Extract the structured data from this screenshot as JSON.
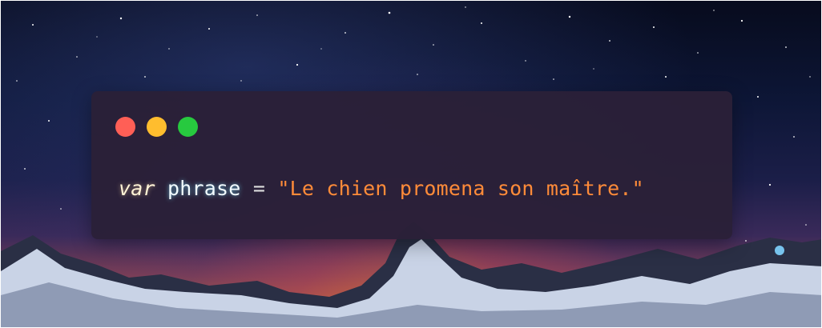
{
  "window": {
    "controls": [
      {
        "name": "close",
        "color": "#ff5f56"
      },
      {
        "name": "minimize",
        "color": "#ffbd2e"
      },
      {
        "name": "maximize",
        "color": "#27c93f"
      }
    ]
  },
  "code": {
    "keyword": "var",
    "identifier": "phrase",
    "operator": "=",
    "string": "\"Le chien promena son maître.\""
  },
  "colors": {
    "window_background": "#2a2038",
    "keyword": "#fff3d6",
    "identifier": "#f2fbff",
    "string": "#ff8b39"
  },
  "background": {
    "description_icon": "night-sky-mountains-image"
  }
}
